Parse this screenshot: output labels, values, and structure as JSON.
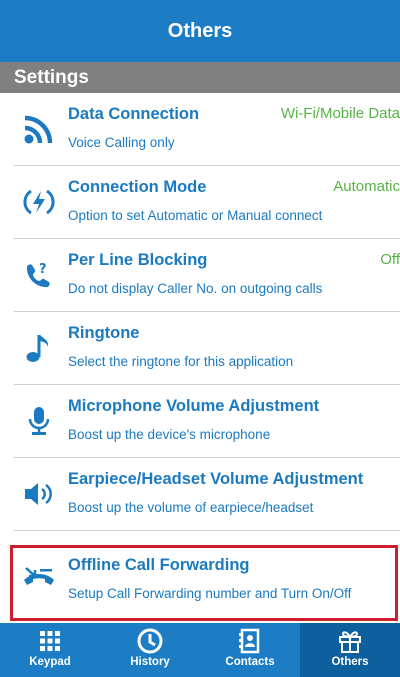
{
  "header": {
    "title": "Others"
  },
  "section": {
    "title": "Settings"
  },
  "settings": [
    {
      "title": "Data Connection",
      "subtitle": "Voice Calling only",
      "value": "Wi-Fi/Mobile Data",
      "icon": "wifi-signal-icon"
    },
    {
      "title": "Connection Mode",
      "subtitle": "Option to set Automatic or Manual connect",
      "value": "Automatic",
      "icon": "lightning-icon"
    },
    {
      "title": "Per Line Blocking",
      "subtitle": "Do not display Caller No. on outgoing calls",
      "value": "Off",
      "icon": "phone-unknown-icon"
    },
    {
      "title": "Ringtone",
      "subtitle": "Select the ringtone for this application",
      "value": "",
      "icon": "music-note-icon"
    },
    {
      "title": "Microphone Volume Adjustment",
      "subtitle": "Boost up the device's microphone",
      "value": "",
      "icon": "microphone-icon"
    },
    {
      "title": "Earpiece/Headset Volume Adjustment",
      "subtitle": "Boost up the volume of earpiece/headset",
      "value": "",
      "icon": "speaker-icon"
    },
    {
      "title": "Offline Call Forwarding",
      "subtitle": "Setup Call Forwarding number and Turn On/Off",
      "value": "",
      "icon": "call-forward-icon"
    }
  ],
  "tabs": [
    {
      "label": "Keypad",
      "icon": "keypad-icon"
    },
    {
      "label": "History",
      "icon": "clock-icon"
    },
    {
      "label": "Contacts",
      "icon": "contacts-book-icon"
    },
    {
      "label": "Others",
      "icon": "gift-icon",
      "active": true
    }
  ],
  "colors": {
    "primary": "#1c7dc4",
    "value_green": "#55b544",
    "highlight": "#cf1f2f",
    "section_gray": "#808080"
  }
}
